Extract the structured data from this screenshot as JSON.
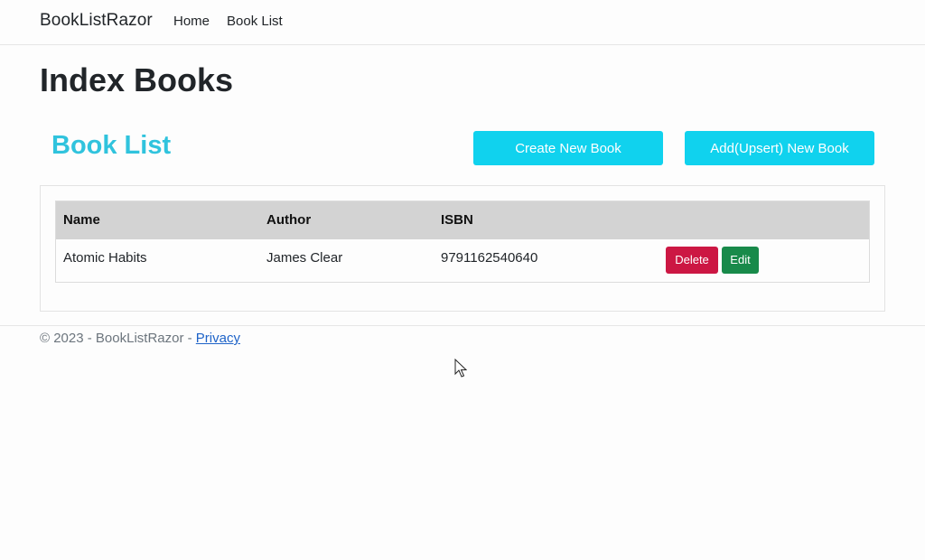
{
  "navbar": {
    "brand": "BookListRazor",
    "links": [
      "Home",
      "Book List"
    ]
  },
  "page": {
    "title": "Index Books",
    "section_title": "Book List",
    "create_button": "Create New Book",
    "upsert_button": "Add(Upsert) New Book"
  },
  "table": {
    "headers": [
      "Name",
      "Author",
      "ISBN"
    ],
    "rows": [
      {
        "name": "Atomic Habits",
        "author": "James Clear",
        "isbn": "9791162540640",
        "delete_label": "Delete",
        "edit_label": "Edit"
      }
    ]
  },
  "footer": {
    "copyright": "© 2023 - BookListRazor - ",
    "privacy_link": "Privacy"
  },
  "colors": {
    "accent": "#30c3dd",
    "info_button": "#10d2ee",
    "danger": "#cc1743",
    "success": "#188a4a",
    "table_header": "#d3d3d3"
  }
}
